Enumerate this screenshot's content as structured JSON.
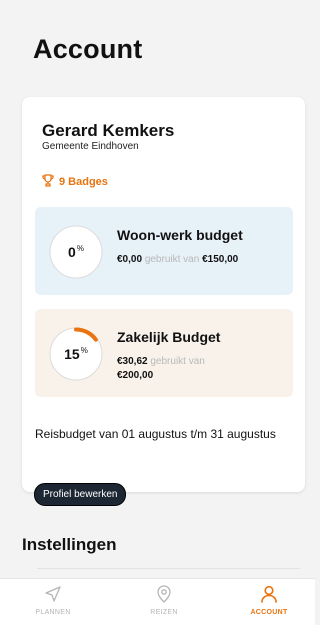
{
  "header": {
    "title": "Account"
  },
  "profile": {
    "name": "Gerard Kemkers",
    "organization": "Gemeente Eindhoven",
    "badges_label": "9 Badges"
  },
  "budgets": [
    {
      "title": "Woon-werk budget",
      "percent": 0,
      "percent_label": "0",
      "percent_sign": "%",
      "used": "€0,00",
      "used_text": "gebruikt van",
      "total": "€150,00",
      "card_color": "#e7f1f8"
    },
    {
      "title": "Zakelijk Budget",
      "percent": 15,
      "percent_label": "15",
      "percent_sign": "%",
      "used": "€30,62",
      "used_text": "gebruikt van",
      "total": "€200,00",
      "card_color": "#f8f2ea"
    }
  ],
  "period_text": "Reisbudget van 01 augustus t/m 31 augustus",
  "edit_button_label": "Profiel bewerken",
  "settings": {
    "title": "Instellingen"
  },
  "tabs": [
    {
      "label": "PLANNEN",
      "icon": "navigation-arrow-icon",
      "active": false
    },
    {
      "label": "REIZEN",
      "icon": "location-pin-icon",
      "active": false
    },
    {
      "label": "ACCOUNT",
      "icon": "person-icon",
      "active": true
    }
  ],
  "colors": {
    "accent": "#e8730f",
    "button_dark": "#1c2733"
  }
}
